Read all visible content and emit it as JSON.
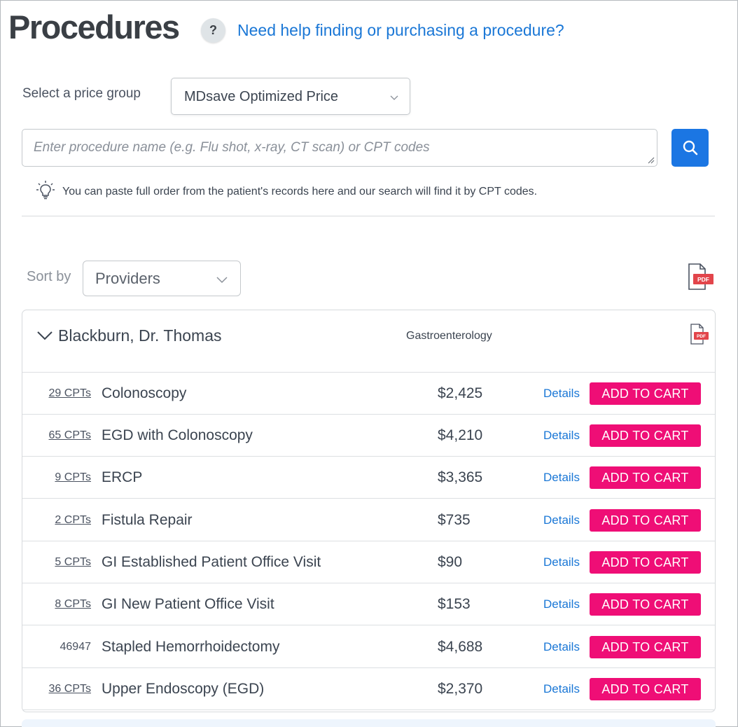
{
  "header": {
    "title": "Procedures",
    "help_badge": "?",
    "help_link": "Need help finding or purchasing a procedure?"
  },
  "price_group": {
    "label": "Select a price group",
    "selected": "MDsave Optimized Price"
  },
  "search": {
    "placeholder": "Enter procedure name (e.g. Flu shot, x-ray, CT scan) or CPT codes",
    "button_icon": "search-icon"
  },
  "tip": {
    "icon": "lightbulb-icon",
    "text": "You can paste full order from the patient's records here and our search will find it by CPT codes."
  },
  "sort": {
    "label": "Sort by",
    "selected": "Providers"
  },
  "provider": {
    "name": "Blackburn, Dr. Thomas",
    "specialty": "Gastroenterology",
    "procedures": [
      {
        "cpts": "29 CPTs",
        "cpts_link": true,
        "name": "Colonoscopy",
        "price": "$2,425",
        "details": "Details",
        "action": "ADD TO CART"
      },
      {
        "cpts": "65 CPTs",
        "cpts_link": true,
        "name": "EGD with Colonoscopy",
        "price": "$4,210",
        "details": "Details",
        "action": "ADD TO CART"
      },
      {
        "cpts": "9 CPTs",
        "cpts_link": true,
        "name": "ERCP",
        "price": "$3,365",
        "details": "Details",
        "action": "ADD TO CART"
      },
      {
        "cpts": "2 CPTs",
        "cpts_link": true,
        "name": "Fistula Repair",
        "price": "$735",
        "details": "Details",
        "action": "ADD TO CART"
      },
      {
        "cpts": "5 CPTs",
        "cpts_link": true,
        "name": "GI Established Patient Office Visit",
        "price": "$90",
        "details": "Details",
        "action": "ADD TO CART"
      },
      {
        "cpts": "8 CPTs",
        "cpts_link": true,
        "name": "GI New Patient Office Visit",
        "price": "$153",
        "details": "Details",
        "action": "ADD TO CART"
      },
      {
        "cpts": "46947",
        "cpts_link": false,
        "name": "Stapled Hemorrhoidectomy",
        "price": "$4,688",
        "details": "Details",
        "action": "ADD TO CART"
      },
      {
        "cpts": "36 CPTs",
        "cpts_link": true,
        "name": "Upper Endoscopy (EGD)",
        "price": "$2,370",
        "details": "Details",
        "action": "ADD TO CART"
      }
    ]
  },
  "colors": {
    "accent_blue": "#1b76e3",
    "link_blue": "#1a77d6",
    "cart_pink": "#ef0e76",
    "pdf_red": "#e2454b"
  }
}
